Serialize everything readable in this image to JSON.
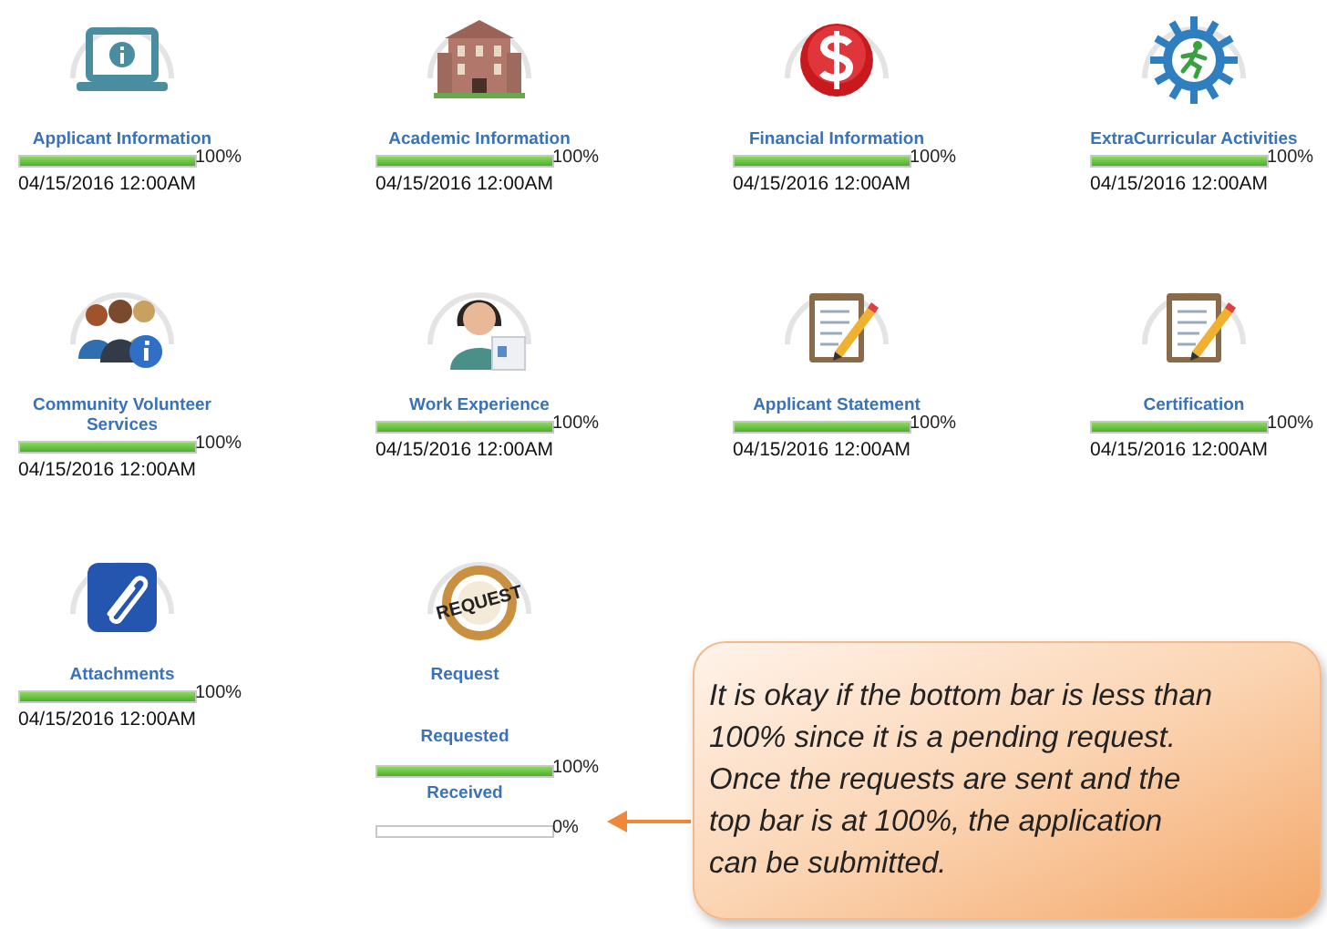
{
  "tiles": [
    {
      "kind": "standard",
      "label": "Applicant Information",
      "level": 1,
      "percent": "100%",
      "date": "04/15/2016 12:00AM"
    },
    {
      "kind": "standard",
      "label": "Academic Information",
      "level": 1,
      "percent": "100%",
      "date": "04/15/2016 12:00AM"
    },
    {
      "kind": "standard",
      "label": "Financial Information",
      "level": 1,
      "percent": "100%",
      "date": "04/15/2016 12:00AM"
    },
    {
      "kind": "standard",
      "label": "ExtraCurricular Activities",
      "level": 1,
      "percent": "100%",
      "date": "04/15/2016 12:00AM"
    },
    {
      "kind": "standard",
      "label": "Community Volunteer Services",
      "level": 1,
      "percent": "100%",
      "date": "04/15/2016 12:00AM"
    },
    {
      "kind": "standard",
      "label": "Work Experience",
      "level": 1,
      "percent": "100%",
      "date": "04/15/2016 12:00AM"
    },
    {
      "kind": "standard",
      "label": "Applicant Statement",
      "level": 1,
      "percent": "100%",
      "date": "04/15/2016 12:00AM"
    },
    {
      "kind": "standard",
      "label": "Certification",
      "level": 1,
      "percent": "100%",
      "date": "04/15/2016 12:00AM"
    },
    {
      "kind": "standard",
      "label": "Attachments",
      "level": 1,
      "percent": "100%",
      "date": "04/15/2016 12:00AM"
    },
    {
      "kind": "request",
      "label": "Request",
      "stamp": "REQUEST",
      "stages": [
        {
          "label": "Requested",
          "level": 1,
          "percent": "100%"
        },
        {
          "label": "Received",
          "level": 0,
          "percent": "0%"
        }
      ]
    }
  ],
  "callout": {
    "text": "It is okay if the bottom bar is less than\n100% since it is a pending request.\nOnce the requests are sent and the\ntop bar is at 100%, the application\ncan be submitted."
  }
}
